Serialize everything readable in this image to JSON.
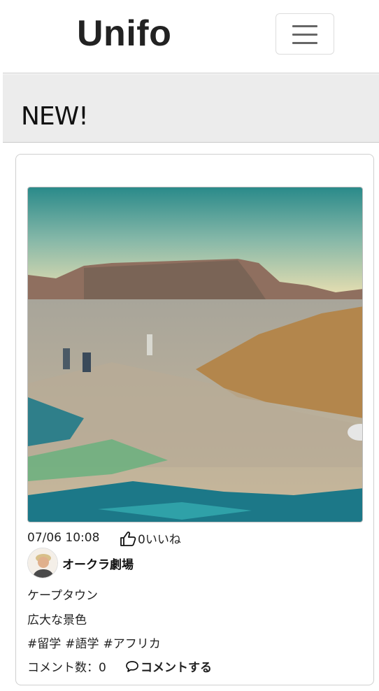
{
  "navbar": {
    "brand": "Unifo",
    "menu_icon": "hamburger-menu-icon"
  },
  "section": {
    "title": "NEW!"
  },
  "post": {
    "timestamp": "07/06 10:08",
    "likes_label": "0いいね",
    "like_icon": "thumbs-up-icon",
    "author": {
      "name": "オークラ劇場",
      "avatar": "author-avatar"
    },
    "title": "ケープタウン",
    "description": "広大な景色",
    "tags": [
      "#留学",
      "#語学",
      "#アフリカ"
    ],
    "comment_count_label": "コメント数：0",
    "comment_action": "コメントする",
    "comment_icon": "speech-bubble-icon",
    "image": "cape-town-aerial-photo"
  },
  "colors": {
    "background": "#ffffff",
    "header_band": "#ececec",
    "border": "#c9c9c9",
    "text": "#222222"
  }
}
